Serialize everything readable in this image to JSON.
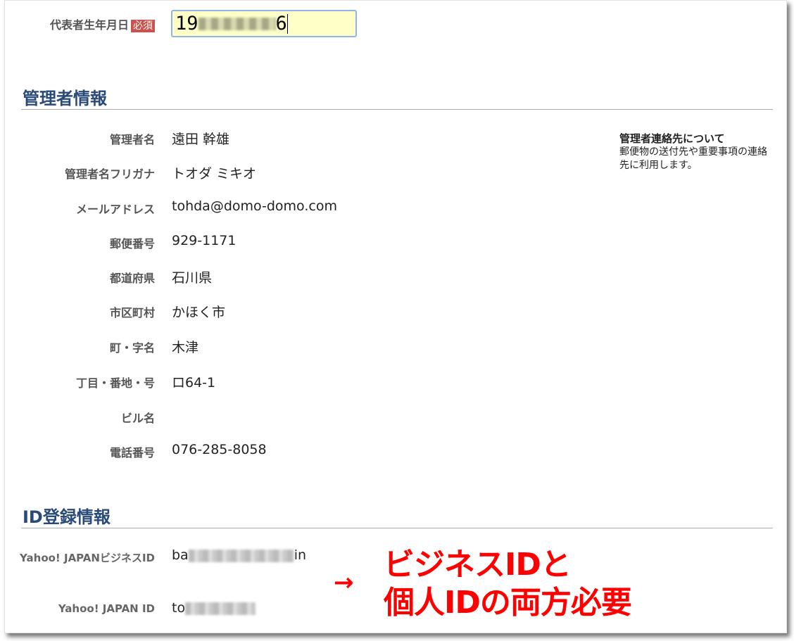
{
  "birth": {
    "label": "代表者生年月日",
    "required": "必須",
    "value_prefix": "19",
    "value_suffix": "6"
  },
  "admin": {
    "heading": "管理者情報",
    "rows": [
      {
        "label": "管理者名",
        "value": "遠田 幹雄"
      },
      {
        "label": "管理者名フリガナ",
        "value": "トオダ ミキオ"
      },
      {
        "label": "メールアドレス",
        "value": "tohda@domo-domo.com"
      },
      {
        "label": "郵便番号",
        "value": "929-1171"
      },
      {
        "label": "都道府県",
        "value": "石川県"
      },
      {
        "label": "市区町村",
        "value": "かほく市"
      },
      {
        "label": "町・字名",
        "value": "木津"
      },
      {
        "label": "丁目・番地・号",
        "value": "ロ64-1"
      },
      {
        "label": "ビル名",
        "value": ""
      },
      {
        "label": "電話番号",
        "value": "076-285-8058"
      }
    ],
    "note_title": "管理者連絡先について",
    "note_body": "郵便物の送付先や重要事項の連絡先に利用します。"
  },
  "id": {
    "heading": "ID登録情報",
    "business_label": "Yahoo! JAPANビジネスID",
    "business_prefix": "ba",
    "business_suffix": "in",
    "personal_label": "Yahoo! JAPAN ID",
    "personal_prefix": "to"
  },
  "annotation": {
    "arrow": "→",
    "line1": "ビジネスIDと",
    "line2": "個人IDの両方必要",
    "color": "#ff0000"
  }
}
